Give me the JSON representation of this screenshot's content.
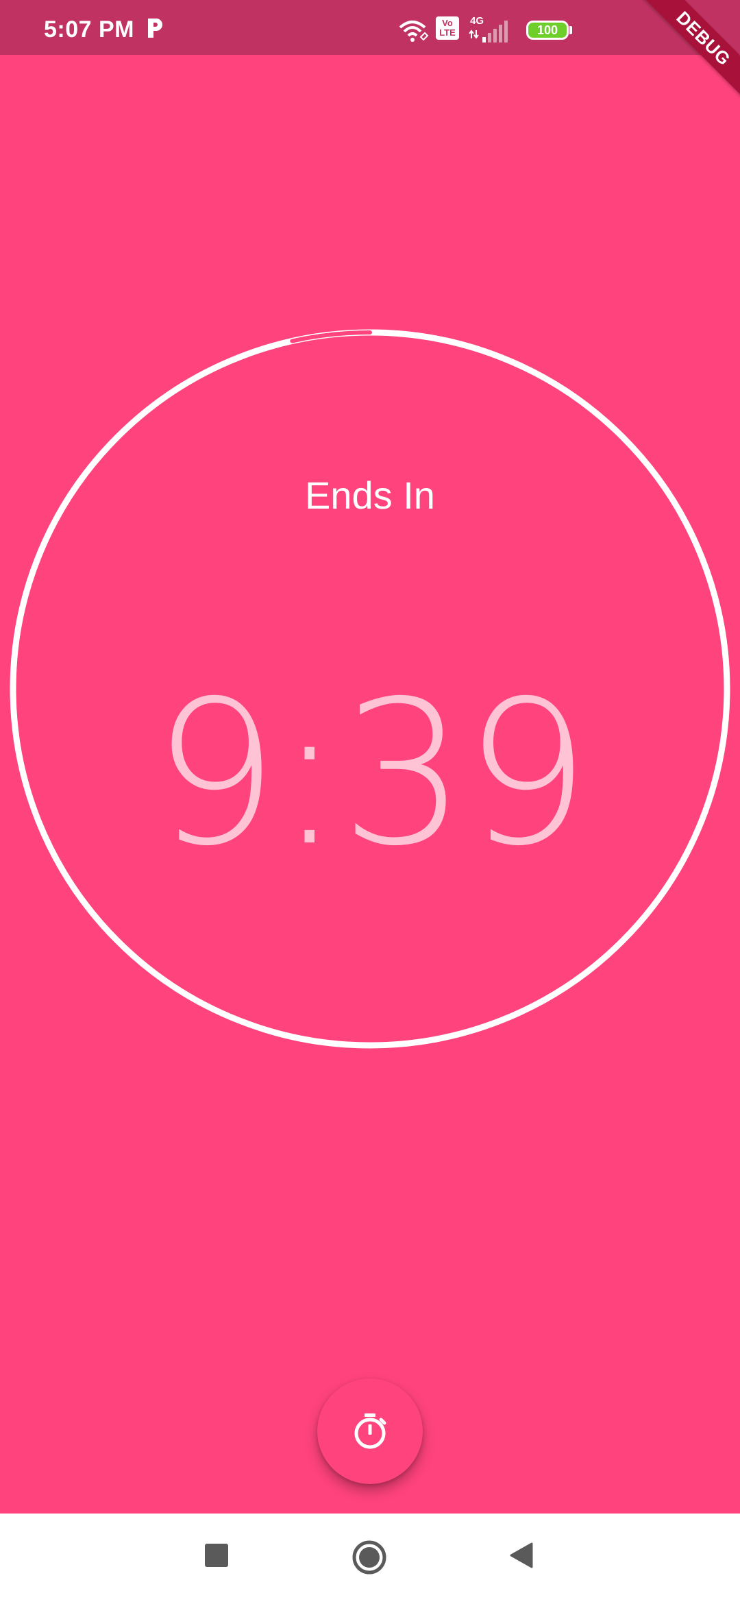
{
  "status_bar": {
    "time": "5:07 PM",
    "battery": "100",
    "network": "4G",
    "volte": "Vo LTE",
    "icons": [
      "p-app-icon",
      "wifi-icon",
      "volte-icon",
      "signal-icon",
      "battery-icon"
    ]
  },
  "debug_banner": {
    "label": "DEBUG"
  },
  "timer": {
    "label": "Ends In",
    "remaining": "9:39",
    "progress_fraction": 0.035
  },
  "fab": {
    "icon": "stopwatch-icon"
  },
  "nav_bar": {
    "icons": [
      "recents-square-icon",
      "home-circle-icon",
      "back-triangle-icon"
    ]
  },
  "colors": {
    "background": "#ff437d",
    "status_bar": "#c03261",
    "ring": "#ffffff",
    "countdown_text": "#ffc3d6",
    "debug_banner": "#a8123a",
    "battery_fill": "#6fcf2a"
  }
}
